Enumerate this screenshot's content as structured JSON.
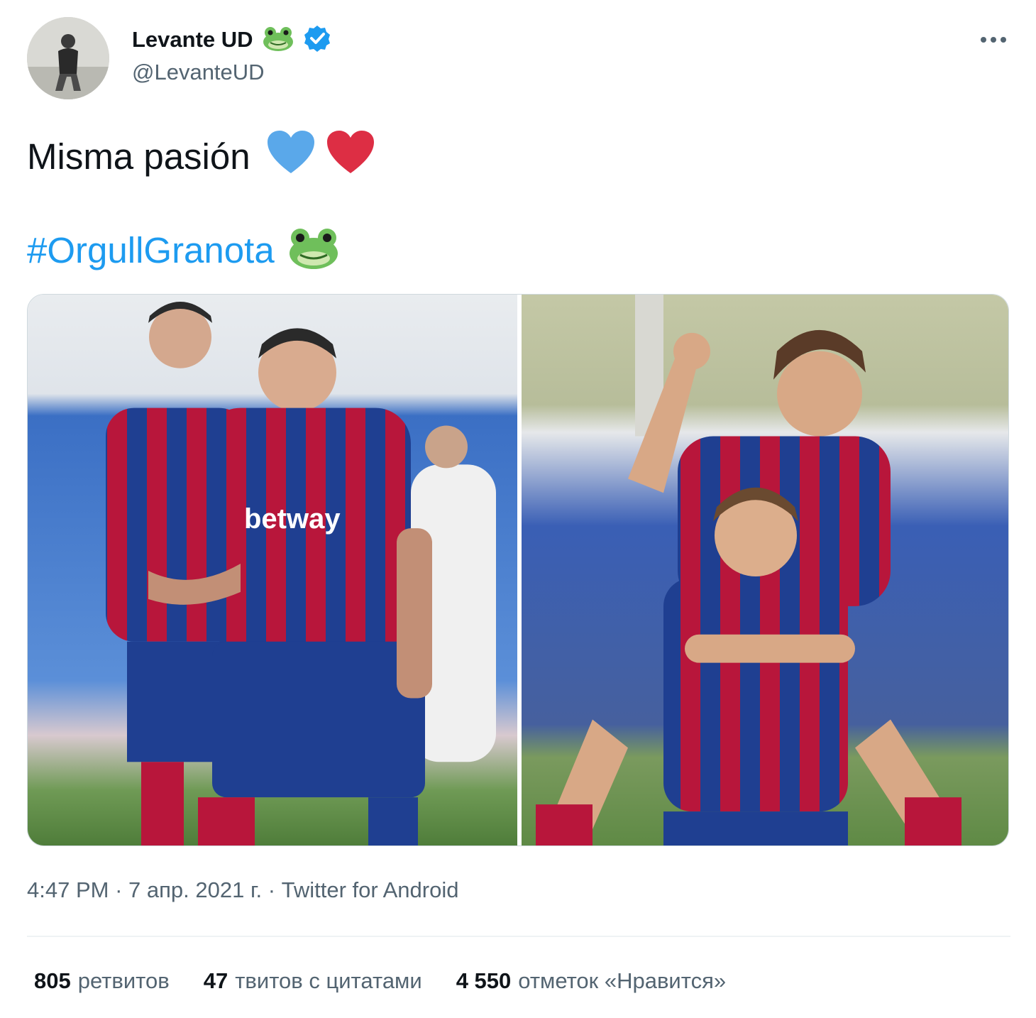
{
  "author": {
    "display_name": "Levante UD",
    "handle": "@LevanteUD",
    "badge_emoji": "frog-face-icon",
    "verified": true
  },
  "tweet": {
    "text": "Misma pasión",
    "hashtag": "#OrgullGranota",
    "emojis": [
      "blue-heart-icon",
      "red-heart-icon",
      "frog-face-icon"
    ]
  },
  "media": {
    "count": 2,
    "photos": [
      "photo-mens-team-celebration",
      "photo-womens-team-celebration"
    ]
  },
  "meta": {
    "time": "4:47 PM",
    "separator": " · ",
    "date": "7 апр. 2021 г.",
    "source": "Twitter for Android"
  },
  "stats": {
    "retweets": {
      "count": "805",
      "label": "ретвитов"
    },
    "quotes": {
      "count": "47",
      "label": "твитов с цитатами"
    },
    "likes": {
      "count": "4 550",
      "label": "отметок «Нравится»"
    }
  },
  "colors": {
    "link": "#1d9bf0",
    "secondary_text": "#536471",
    "primary_text": "#0f1419",
    "verified": "#1d9bf0",
    "levante_blue": "#1f3f91",
    "levante_red": "#b8163b"
  }
}
